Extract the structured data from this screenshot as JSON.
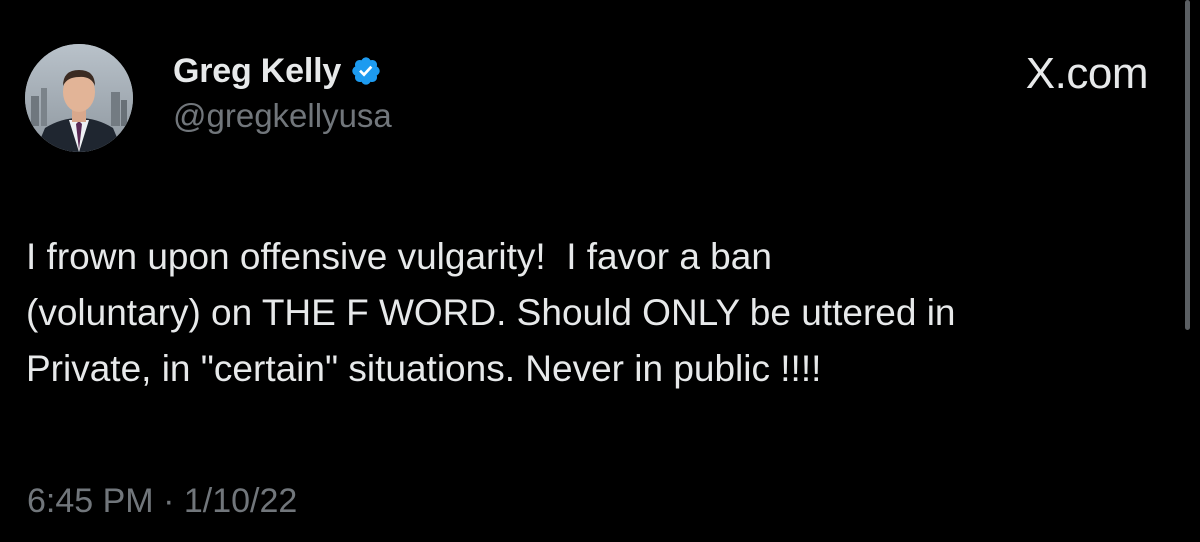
{
  "author": {
    "display_name": "Greg Kelly",
    "handle": "@gregkellyusa",
    "verified": true,
    "verified_color": "#1d9bf0",
    "avatar_icon": "profile-photo"
  },
  "brand": {
    "label": "X.com"
  },
  "tweet": {
    "text": "I frown upon offensive vulgarity!  I favor a ban\n(voluntary) on THE F WORD. Should ONLY be uttered in\nPrivate, in \"certain\" situations. Never in public !!!!",
    "timestamp": "6:45 PM · 1/10/22"
  },
  "colors": {
    "background": "#000000",
    "primary_text": "#e7e9ea",
    "secondary_text": "#71767b"
  }
}
